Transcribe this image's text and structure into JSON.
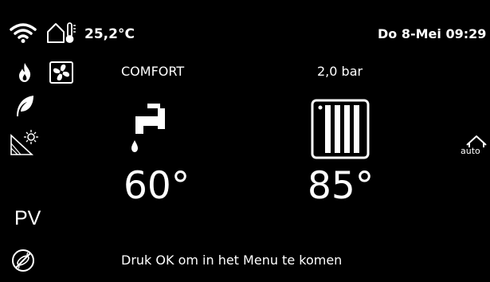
{
  "status_bar": {
    "outside_temperature": "25,2°C",
    "datetime": "Do 8-Mei 09:29"
  },
  "main": {
    "mode": "COMFORT",
    "pressure": "2,0 bar",
    "dhw_setpoint": "60°",
    "heating_setpoint": "85°",
    "auto_label": "auto"
  },
  "sidebar": {
    "pv_label": "PV"
  },
  "footer": {
    "hint": "Druk OK om in het Menu te komen"
  },
  "icons": {
    "wifi": "wifi-icon",
    "outside_temp": "house-thermometer-icon",
    "flame": "flame-icon",
    "fan": "fan-icon",
    "eco": "leaf-icon",
    "solar": "solar-panel-icon",
    "no_legionella": "no-legionella-icon",
    "dhw": "hot-water-tap-icon",
    "radiator": "radiator-icon",
    "auto": "house-auto-icon"
  },
  "colors": {
    "background": "#000000",
    "foreground": "#ffffff"
  }
}
